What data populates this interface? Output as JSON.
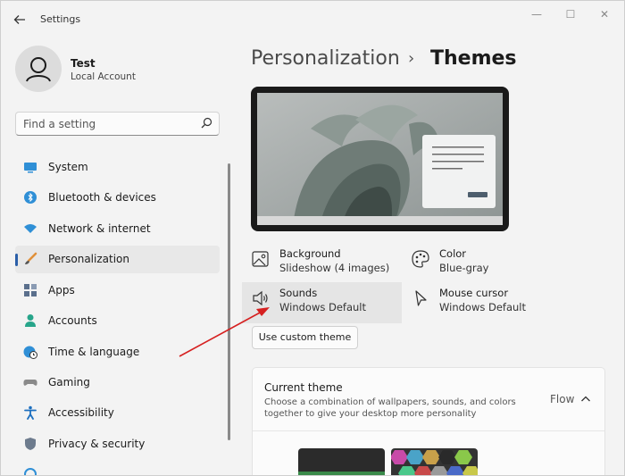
{
  "window": {
    "title": "Settings",
    "controls": {
      "minimize": "—",
      "maximize": "☐",
      "close": "✕"
    }
  },
  "user": {
    "name": "Test",
    "account_type": "Local Account"
  },
  "search": {
    "placeholder": "Find a setting"
  },
  "sidebar": {
    "items": [
      {
        "label": "System",
        "icon": "system-icon",
        "active": false
      },
      {
        "label": "Bluetooth & devices",
        "icon": "bluetooth-icon",
        "active": false
      },
      {
        "label": "Network & internet",
        "icon": "wifi-icon",
        "active": false
      },
      {
        "label": "Personalization",
        "icon": "brush-icon",
        "active": true
      },
      {
        "label": "Apps",
        "icon": "apps-icon",
        "active": false
      },
      {
        "label": "Accounts",
        "icon": "person-icon",
        "active": false
      },
      {
        "label": "Time & language",
        "icon": "globe-clock-icon",
        "active": false
      },
      {
        "label": "Gaming",
        "icon": "gamepad-icon",
        "active": false
      },
      {
        "label": "Accessibility",
        "icon": "accessibility-icon",
        "active": false
      },
      {
        "label": "Privacy & security",
        "icon": "shield-icon",
        "active": false
      }
    ]
  },
  "breadcrumb": {
    "parent": "Personalization",
    "separator": "›",
    "current": "Themes"
  },
  "tiles": {
    "background": {
      "title": "Background",
      "value": "Slideshow (4 images)"
    },
    "color": {
      "title": "Color",
      "value": "Blue-gray"
    },
    "sounds": {
      "title": "Sounds",
      "value": "Windows Default"
    },
    "mouse_cursor": {
      "title": "Mouse cursor",
      "value": "Windows Default"
    }
  },
  "custom_theme_button": "Use custom theme",
  "current_theme": {
    "title": "Current theme",
    "description": "Choose a combination of wallpapers, sounds, and colors together to give your desktop more personality",
    "value": "Flow"
  },
  "colors": {
    "accent": "#2b5fa8",
    "annotation_arrow": "#d62020"
  }
}
